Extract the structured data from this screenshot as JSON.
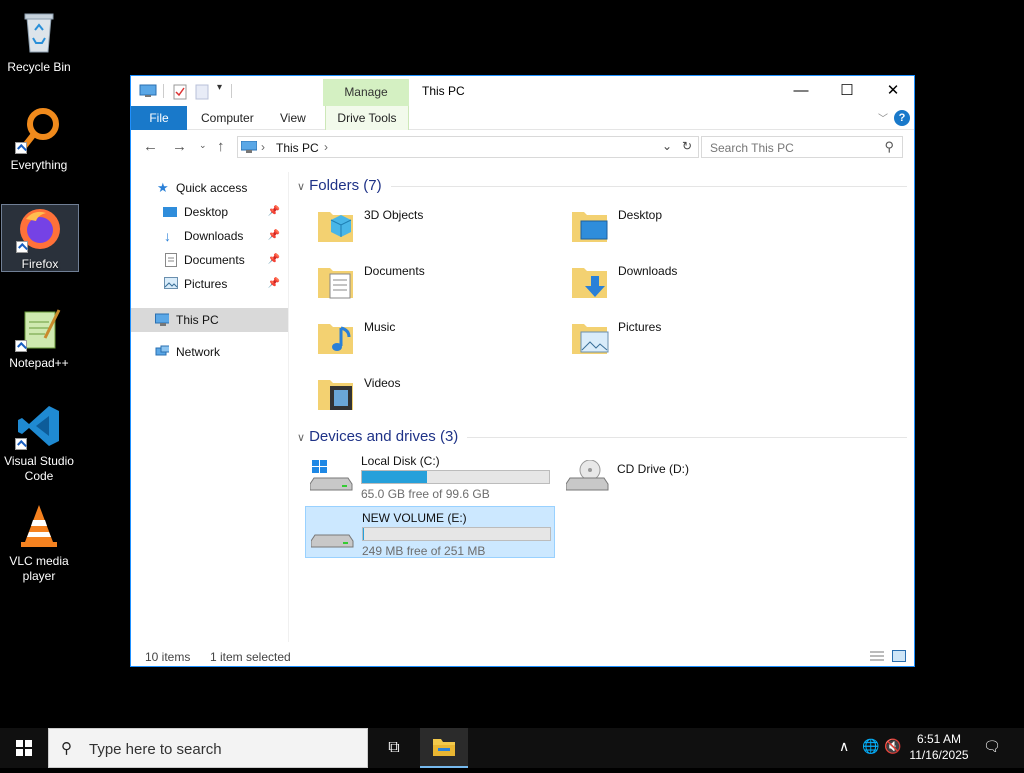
{
  "desktop": {
    "icons": [
      {
        "label": "Recycle Bin",
        "icon": "recycle-bin-icon"
      },
      {
        "label": "Everything",
        "icon": "everything-search-icon"
      },
      {
        "label": "Firefox",
        "icon": "firefox-icon"
      },
      {
        "label": "Notepad++",
        "icon": "notepad-plus-plus-icon"
      },
      {
        "label": "Visual Studio Code",
        "icon": "vscode-icon"
      },
      {
        "label": "VLC media player",
        "icon": "vlc-icon"
      }
    ]
  },
  "window": {
    "title": "This PC",
    "manage_tab": "Manage",
    "ribbon_tabs": {
      "file": "File",
      "computer": "Computer",
      "view": "View",
      "drive_tools": "Drive Tools"
    },
    "address_path": "This PC",
    "search_placeholder": "Search This PC",
    "nav": {
      "quick_access": "Quick access",
      "desktop": "Desktop",
      "downloads": "Downloads",
      "documents": "Documents",
      "pictures": "Pictures",
      "this_pc": "This PC",
      "network": "Network"
    },
    "folders_header": "Folders (7)",
    "folders": [
      "3D Objects",
      "Desktop",
      "Documents",
      "Downloads",
      "Music",
      "Pictures",
      "Videos"
    ],
    "devices_header": "Devices and drives (3)",
    "drives": [
      {
        "name": "Local Disk (C:)",
        "free_text": "65.0 GB free of 99.6 GB",
        "used_fraction": 0.347
      },
      {
        "name": "CD Drive (D:)"
      },
      {
        "name": "NEW VOLUME (E:)",
        "free_text": "249 MB free of 251 MB",
        "used_fraction": 0.008
      }
    ],
    "status": {
      "items": "10 items",
      "selected": "1 item selected"
    }
  },
  "taskbar": {
    "search_placeholder": "Type here to search",
    "time": "6:51 AM",
    "date": "11/16/2025"
  },
  "colors": {
    "accent": "#1979ca",
    "manage_tab": "#d4f0c2",
    "drive_bar": "#26a0da",
    "selection": "#cce8ff"
  }
}
